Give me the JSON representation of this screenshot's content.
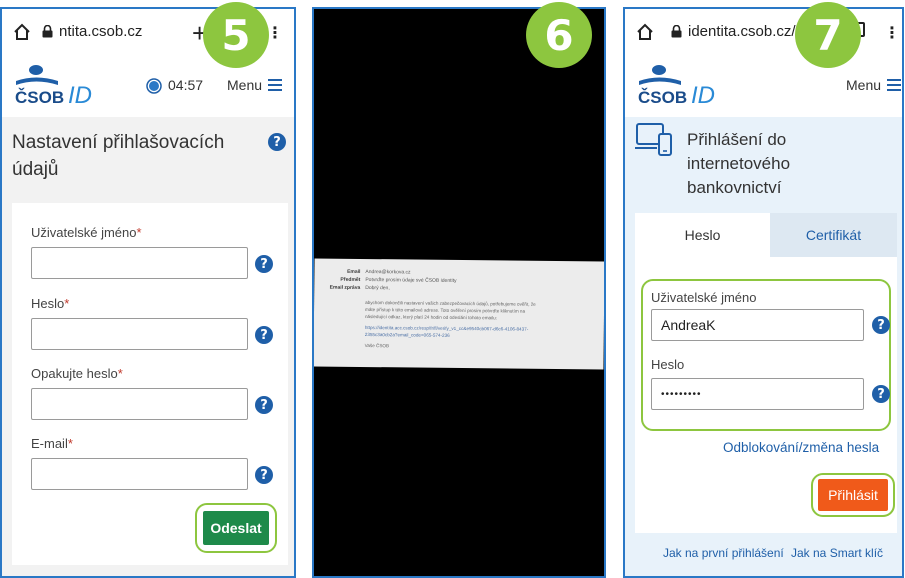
{
  "screen5": {
    "badge": "5",
    "url": "ntita.csob.cz",
    "new_tab_glyph": "+",
    "logo_text": "ČSOB",
    "logo_id": "ID",
    "timer": "04:57",
    "menu_label": "Menu",
    "title_line1": "Nastavení přihlašovacích",
    "title_line2": "údajů",
    "fields": [
      {
        "label": "Uživatelské jméno",
        "required": "*"
      },
      {
        "label": "Heslo",
        "required": "*"
      },
      {
        "label": "Opakujte heslo",
        "required": "*"
      },
      {
        "label": "E-mail",
        "required": "*"
      }
    ],
    "submit_label": "Odeslat"
  },
  "screen6": {
    "badge": "6",
    "email_labels": [
      "Email",
      "Předmět",
      "Email zpráva"
    ],
    "email_values": [
      "Andrea@korkova.cz",
      "Potvrďte prosím údaje své ČSOB identity",
      "Dobrý den,"
    ],
    "email_body": [
      "abychom dokončili nastavení vašich zabezpečovacích údajů, potřebujeme ověřit, že",
      "máte přístup k této emailové adrese. Toto ověření prosím potvrďte kliknutím na",
      "následující odkaz, který platí 24 hodin od odeslání tohoto emailu:",
      "https://identita.acc.csob.cz/resp/fr/fl/verify_v1_cc&e9540cb067-d6c6-4106-8437-",
      "2355c3a0cb2a?email_code=065-574-236",
      "Vaše ČSOB"
    ]
  },
  "screen7": {
    "badge": "7",
    "url": "identita.csob.cz/",
    "logo_text": "ČSOB",
    "logo_id": "ID",
    "menu_label": "Menu",
    "title_line1": "Přihlášení do",
    "title_line2": "internetového",
    "title_line3": "bankovnictví",
    "tab_active": "Heslo",
    "tab_inactive": "Certifikát",
    "username_label": "Uživatelské jméno",
    "username_value": "AndreaK",
    "password_label": "Heslo",
    "password_value": "•••••••••",
    "unblock_link": "Odblokování/změna hesla",
    "login_button": "Přihlásit",
    "footer_link1": "Jak na první přihlášení",
    "footer_link2": "Jak na Smart klíč"
  },
  "colors": {
    "accent_blue": "#1f5fa8",
    "highlight_green": "#8dc63f",
    "submit_green": "#1e8a4a",
    "login_orange": "#f05a1a",
    "frame_blue": "#2a78c6"
  }
}
